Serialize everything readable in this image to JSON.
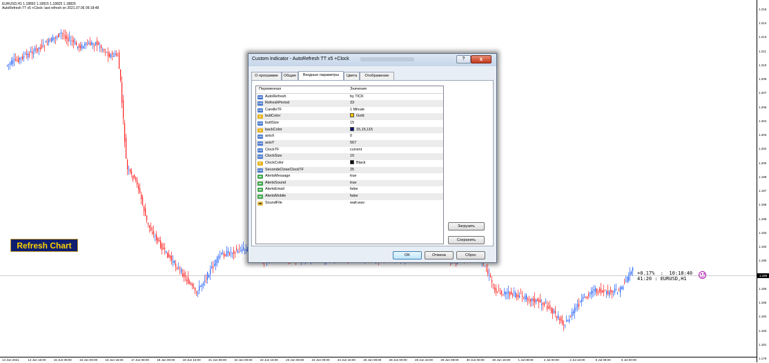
{
  "chart": {
    "header_line1": "EURUSD,H1  1.18892 1.18915 1.18825 1.18826",
    "header_line2": "AutoRefresh TT x5 +Clock:  last refresh on 2021.07.06 09:18:48",
    "colors": {
      "up": "#1f5fff",
      "down": "#ff1a1a",
      "background": "#ffffff"
    },
    "price_labels": [
      "1.216",
      "1.214",
      "1.213",
      "1.211",
      "1.210",
      "1.209",
      "1.207",
      "1.206",
      "1.204",
      "1.203",
      "1.202",
      "1.200",
      "1.199",
      "1.197",
      "1.196",
      "1.195",
      "1.193",
      "1.192",
      "1.190",
      "1.189",
      "1.186",
      "1.185",
      "1.184",
      "1.183",
      "1.181",
      "1.179"
    ],
    "current_price": "1.188",
    "time_labels": [
      "14 Jun 2021",
      "14 Jun 16:00",
      "15 Jun 08:00",
      "16 Jun 00:00",
      "16 Jun 16:00",
      "17 Jun 08:00",
      "18 Jun 00:00",
      "18 Jun 16:00",
      "21 Jun 08:00",
      "22 Jun 00:00",
      "22 Jun 16:00",
      "23 Jun 08:00",
      "24 Jun 00:00",
      "24 Jun 16:00",
      "25 Jun 08:00",
      "28 Jun 00:00",
      "28 Jun 16:00",
      "29 Jun 08:00",
      "30 Jun 00:00",
      "30 Jun 16:00",
      "1 Jul 08:00",
      "2 Jul 00:00",
      "2 Jul 16:00",
      "5 Jul 08:00",
      "6 Jul 00:00"
    ],
    "refresh_button": "Refresh Chart",
    "clock_line1": "+0.17%  :  10:18:40",
    "clock_line2": "41:20 : EURUSD,H1",
    "smiley_icon": "smiley-icon"
  },
  "dialog": {
    "title": "Custom Indicator - AutoRefresh TT x5 +Clock",
    "help_label": "?",
    "close_label": "x",
    "tabs": [
      "О программе",
      "Общие",
      "Входные параметры",
      "Цвета",
      "Отображение"
    ],
    "active_tab": 2,
    "columns": [
      "Переменная",
      "Значение"
    ],
    "params": [
      {
        "icon": "num",
        "name": "AutoRefresh",
        "value": "by TICK"
      },
      {
        "icon": "num",
        "name": "RefreshPeriod",
        "value": "33"
      },
      {
        "icon": "num",
        "name": "CandleTF",
        "value": "1 Minute"
      },
      {
        "icon": "color",
        "name": "buttColor",
        "value": "Gold",
        "swatch": "#f2c000"
      },
      {
        "icon": "num",
        "name": "buttSize",
        "value": "15"
      },
      {
        "icon": "color",
        "name": "backColor",
        "value": "15,15,115",
        "swatch": "#0f0f73"
      },
      {
        "icon": "num",
        "name": "axisX",
        "value": "0"
      },
      {
        "icon": "num",
        "name": "axisY",
        "value": "567"
      },
      {
        "icon": "num",
        "name": "ClockTF",
        "value": "current"
      },
      {
        "icon": "num",
        "name": "ClockSize",
        "value": "10"
      },
      {
        "icon": "color",
        "name": "ClockColor",
        "value": "Black",
        "swatch": "#000000"
      },
      {
        "icon": "num",
        "name": "SecondsCloseClockTF",
        "value": "25"
      },
      {
        "icon": "bool",
        "name": "AlertsMessage",
        "value": "true"
      },
      {
        "icon": "bool",
        "name": "AlertsSound",
        "value": "true"
      },
      {
        "icon": "bool",
        "name": "AlertsEmail",
        "value": "false"
      },
      {
        "icon": "bool",
        "name": "AlertsMobile",
        "value": "false"
      },
      {
        "icon": "str",
        "name": "SoundFile",
        "value": "wait.wav"
      }
    ],
    "buttons": {
      "load": "Загрузить",
      "save": "Сохранить",
      "ok": "OK",
      "cancel": "Отмена",
      "reset": "Сброс"
    }
  }
}
